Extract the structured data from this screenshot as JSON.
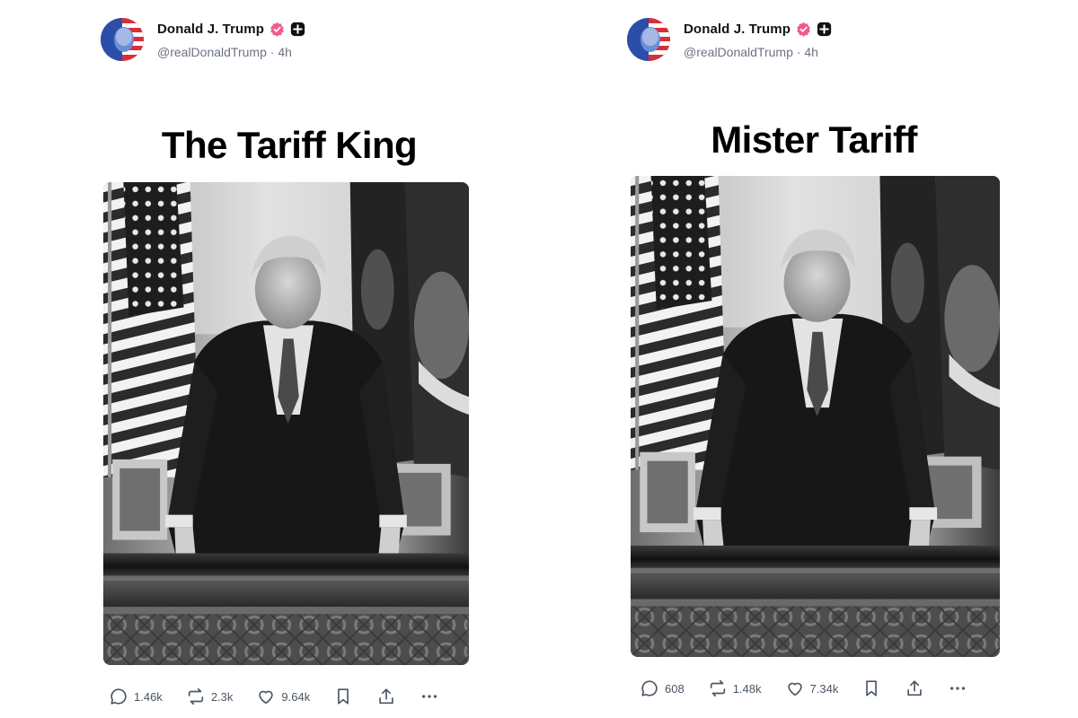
{
  "posts": [
    {
      "author_name": "Donald J. Trump",
      "handle": "@realDonaldTrump",
      "separator": "·",
      "time": "4h",
      "caption": "The Tariff King",
      "comments": "1.46k",
      "reposts": "2.3k",
      "likes": "9.64k"
    },
    {
      "author_name": "Donald J. Trump",
      "handle": "@realDonaldTrump",
      "separator": "·",
      "time": "4h",
      "caption": "Mister Tariff",
      "comments": "608",
      "reposts": "1.48k",
      "likes": "7.34k"
    }
  ],
  "colors": {
    "verified_badge": "#ef5b8b",
    "plus_badge": "#111111",
    "muted_text": "#6b7280"
  },
  "icons": {
    "comment": "comment-icon",
    "repost": "repost-icon",
    "like": "heart-icon",
    "bookmark": "bookmark-icon",
    "share": "share-icon",
    "more": "more-icon",
    "verified": "verified-badge-icon",
    "plus": "plus-badge-icon"
  }
}
